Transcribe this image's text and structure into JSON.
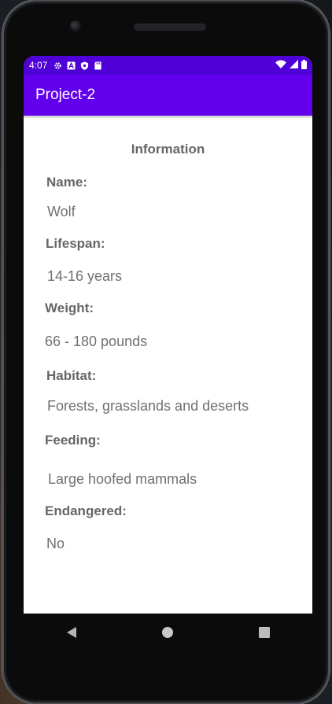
{
  "status_bar": {
    "time": "4:07",
    "icons_left": [
      "gear-icon",
      "a-icon",
      "shield-icon",
      "sd-card-icon"
    ],
    "icons_right": [
      "wifi-icon",
      "signal-icon",
      "battery-icon"
    ]
  },
  "app_bar": {
    "title": "Project-2"
  },
  "info": {
    "heading": "Information",
    "name_label": "Name:",
    "name_value": "Wolf",
    "lifespan_label": "Lifespan:",
    "lifespan_value": "14-16 years",
    "weight_label": "Weight:",
    "weight_value": "66 - 180 pounds",
    "habitat_label": "Habitat:",
    "habitat_value": "Forests, grasslands and deserts",
    "feeding_label": "Feeding:",
    "feeding_value": "Large hoofed mammals",
    "endangered_label": "Endangered:",
    "endangered_value": "No"
  },
  "colors": {
    "status_bar": "#4e00d6",
    "app_bar": "#6200ee",
    "text": "#707070"
  },
  "nav_bar": {
    "buttons": [
      "back-icon",
      "home-icon",
      "recents-icon"
    ]
  }
}
